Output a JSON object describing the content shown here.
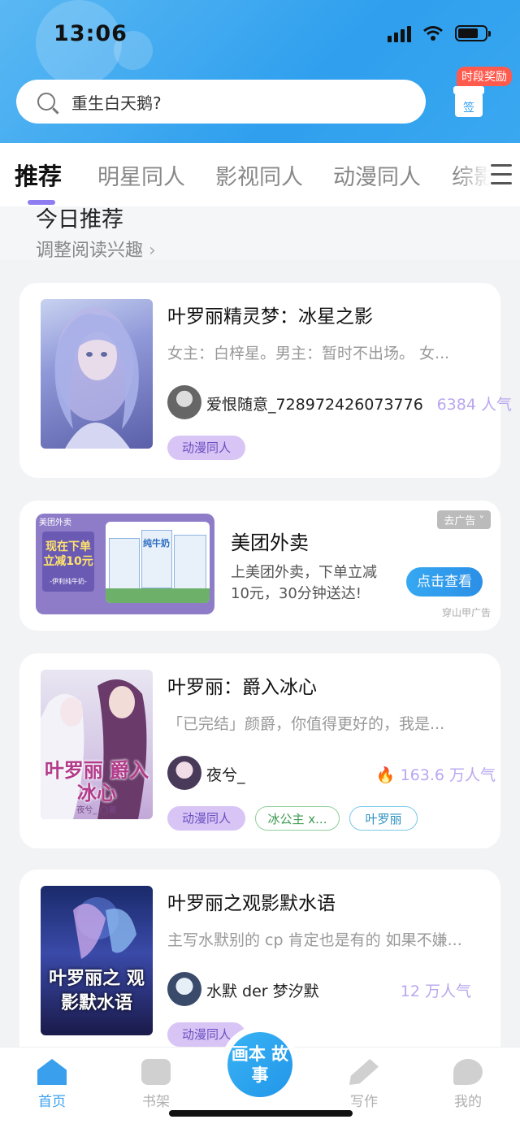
{
  "status_bar": {
    "time": "13:06"
  },
  "search": {
    "placeholder": "重生白天鹅?"
  },
  "reward": {
    "tag": "时段奖励",
    "label": "签"
  },
  "tabs": [
    {
      "label": "推荐",
      "active": true
    },
    {
      "label": "明星同人"
    },
    {
      "label": "影视同人"
    },
    {
      "label": "动漫同人"
    },
    {
      "label": "综影"
    }
  ],
  "today": {
    "title": "今日推荐",
    "subtitle": "调整阅读兴趣"
  },
  "books": [
    {
      "title": "叶罗丽精灵梦：冰星之影",
      "desc": "女主：白梓星。男主：暂时不出场。 女...",
      "author": "爱恨随意_728972426073776",
      "popularity": "6384 人气",
      "tags": [
        "动漫同人"
      ]
    },
    {
      "title": "叶罗丽：爵入冰心",
      "desc": "「已完结」颜爵，你值得更好的，我是...",
      "author": "夜兮_",
      "popularity": "163.6 万人气",
      "tags": [
        "动漫同人",
        "冰公主 x...",
        "叶罗丽"
      ],
      "cover_title": "叶罗丽 爵入冰心",
      "cover_author": "夜兮_ ◯著"
    },
    {
      "title": "叶罗丽之观影默水语",
      "desc": "主写水默别的 cp 肯定也是有的 如果不嫌...",
      "author": "水默 der 梦汐默",
      "popularity": "12 万人气",
      "tags": [
        "动漫同人"
      ],
      "cover_title": "叶罗丽之 观影默水语"
    }
  ],
  "ad": {
    "title": "美团外卖",
    "desc": "上美团外卖，下单立减 10元，30分钟送达!",
    "button": "点击查看",
    "tag": "去广告 ˅",
    "source": "穿山甲广告",
    "img_brand": "美团外卖",
    "img_headline": "现在下单 立减10元",
    "img_sub": "-伊利纯牛奶-",
    "img_product": "纯牛奶"
  },
  "bottom_nav": [
    {
      "label": "首页",
      "icon": "home-icon",
      "active": true
    },
    {
      "label": "书架",
      "icon": "bookshelf-icon"
    },
    {
      "label": "写作",
      "icon": "pen-icon"
    },
    {
      "label": "我的",
      "icon": "chat-bubble-icon"
    }
  ],
  "fab": {
    "label": "画本 故事"
  },
  "colors": {
    "accent": "#2f9fee",
    "tab_indicator": "#8e7cf1",
    "popularity": "#b9a7ef"
  }
}
